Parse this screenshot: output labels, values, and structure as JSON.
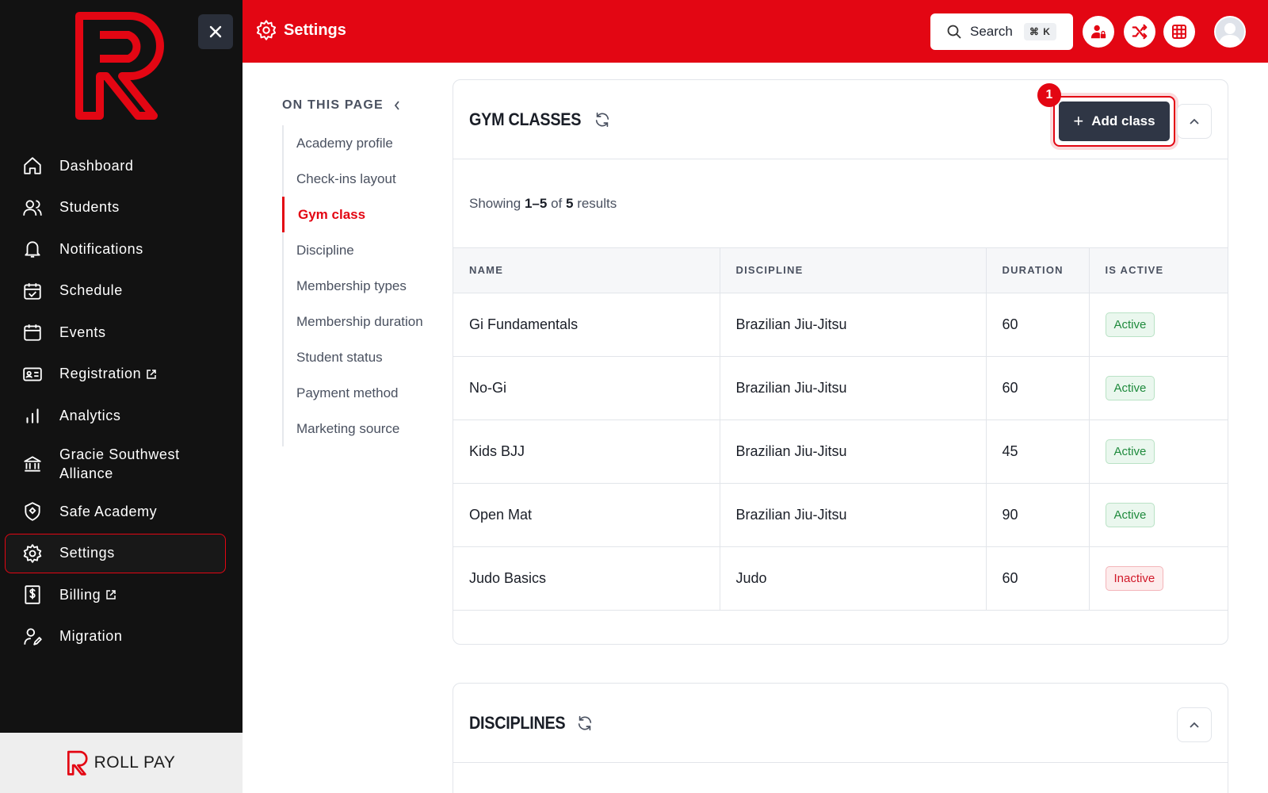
{
  "brand": {
    "footer_name": "ROLL PAY",
    "accent": "#e30613"
  },
  "sidebar": {
    "items": [
      {
        "label": "Dashboard",
        "icon": "home-icon"
      },
      {
        "label": "Students",
        "icon": "users-icon"
      },
      {
        "label": "Notifications",
        "icon": "bell-icon"
      },
      {
        "label": "Schedule",
        "icon": "calendar-check-icon"
      },
      {
        "label": "Events",
        "icon": "calendar-icon"
      },
      {
        "label": "Registration",
        "icon": "id-card-icon",
        "external": true
      },
      {
        "label": "Analytics",
        "icon": "bar-chart-icon"
      },
      {
        "label": "Gracie Southwest Alliance",
        "icon": "bank-icon"
      },
      {
        "label": "Safe Academy",
        "icon": "shield-icon"
      },
      {
        "label": "Settings",
        "icon": "gear-icon",
        "active": true
      },
      {
        "label": "Billing",
        "icon": "dollar-doc-icon",
        "external": true
      },
      {
        "label": "Migration",
        "icon": "user-edit-icon"
      }
    ]
  },
  "header": {
    "title": "Settings",
    "search_label": "Search",
    "search_shortcut": "⌘ K"
  },
  "on_this_page": {
    "title": "ON THIS PAGE",
    "items": [
      {
        "label": "Academy profile"
      },
      {
        "label": "Check-ins layout"
      },
      {
        "label": "Gym class",
        "active": true
      },
      {
        "label": "Discipline"
      },
      {
        "label": "Membership types"
      },
      {
        "label": "Membership duration"
      },
      {
        "label": "Student status"
      },
      {
        "label": "Payment method"
      },
      {
        "label": "Marketing source"
      }
    ]
  },
  "gym_classes": {
    "title": "GYM CLASSES",
    "add_label": "Add class",
    "step_number": "1",
    "results_prefix": "Showing ",
    "results_range": "1–5",
    "results_mid": " of ",
    "results_total": "5",
    "results_suffix": " results",
    "columns": [
      "NAME",
      "DISCIPLINE",
      "DURATION",
      "IS ACTIVE"
    ],
    "rows": [
      {
        "name": "Gi Fundamentals",
        "discipline": "Brazilian Jiu-Jitsu",
        "duration": "60",
        "status": "Active"
      },
      {
        "name": "No-Gi",
        "discipline": "Brazilian Jiu-Jitsu",
        "duration": "60",
        "status": "Active"
      },
      {
        "name": "Kids BJJ",
        "discipline": "Brazilian Jiu-Jitsu",
        "duration": "45",
        "status": "Active"
      },
      {
        "name": "Open Mat",
        "discipline": "Brazilian Jiu-Jitsu",
        "duration": "90",
        "status": "Active"
      },
      {
        "name": "Judo Basics",
        "discipline": "Judo",
        "duration": "60",
        "status": "Inactive"
      }
    ]
  },
  "disciplines": {
    "title": "DISCIPLINES"
  }
}
